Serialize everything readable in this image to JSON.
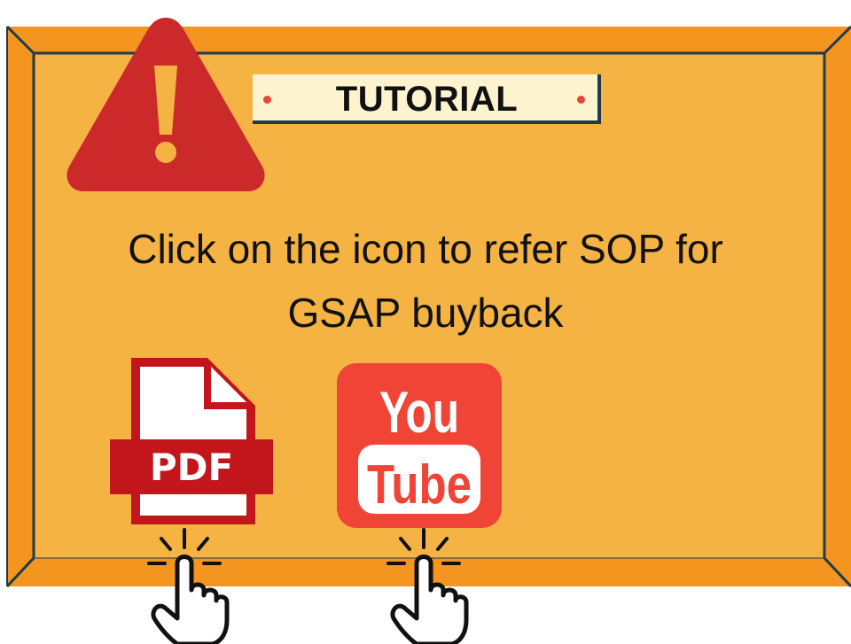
{
  "badge": {
    "label": "TUTORIAL"
  },
  "instruction": {
    "line1": "Click on the icon to refer SOP for",
    "line2": "GSAP buyback"
  },
  "pdf": {
    "label": "PDF"
  },
  "youtube": {
    "line1": "You",
    "line2": "Tube"
  },
  "icons": {
    "warning": "warning-triangle-icon",
    "pdf": "pdf-file-icon",
    "youtube": "youtube-icon",
    "tap": "tap-hand-icon"
  },
  "colors": {
    "frame_outer": "#f4951f",
    "frame_inner": "#f4b343",
    "frame_line": "#1f3a4d",
    "warning_red": "#cc2a2a",
    "pdf_red": "#c2161c",
    "youtube_red": "#f04436",
    "badge_bg": "#fdf3cf",
    "dot_red": "#e5473b"
  }
}
